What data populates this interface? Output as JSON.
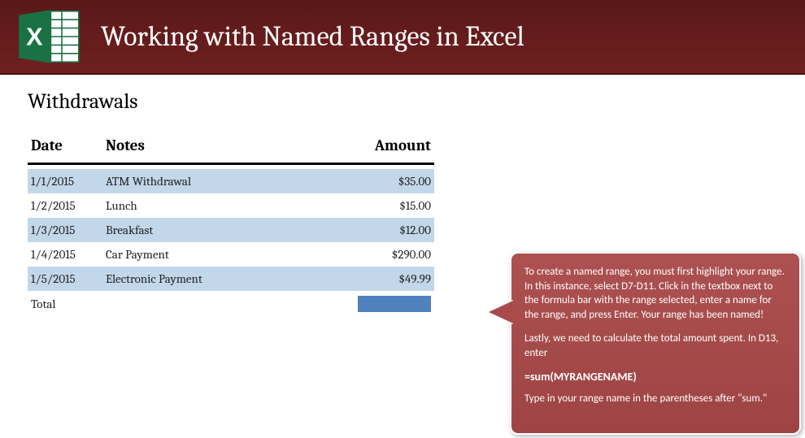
{
  "header": {
    "title": "Working with Named Ranges in Excel",
    "icon_name": "excel-icon"
  },
  "section": {
    "title": "Withdrawals",
    "columns": {
      "date": "Date",
      "notes": "Notes",
      "amount": "Amount"
    },
    "rows": [
      {
        "date": "1/1/2015",
        "notes": "ATM Withdrawal",
        "amount": "$35.00"
      },
      {
        "date": "1/2/2015",
        "notes": "Lunch",
        "amount": "$15.00"
      },
      {
        "date": "1/3/2015",
        "notes": "Breakfast",
        "amount": "$12.00"
      },
      {
        "date": "1/4/2015",
        "notes": "Car Payment",
        "amount": "$290.00"
      },
      {
        "date": "1/5/2015",
        "notes": "Electronic Payment",
        "amount": "$49.99"
      }
    ],
    "total_label": "Total"
  },
  "callout": {
    "para1": "To create a named range, you must first highlight your range. In this instance, select D7-D11. Click in the textbox next to the formula bar with the range selected, enter a name for the range, and press Enter. Your range has been named!",
    "para2": "Lastly, we need to calculate the total amount spent. In D13, enter",
    "formula": "=sum(MYRANGENAME)",
    "para3": "Type in your range name in the parentheses after \"sum.\""
  }
}
